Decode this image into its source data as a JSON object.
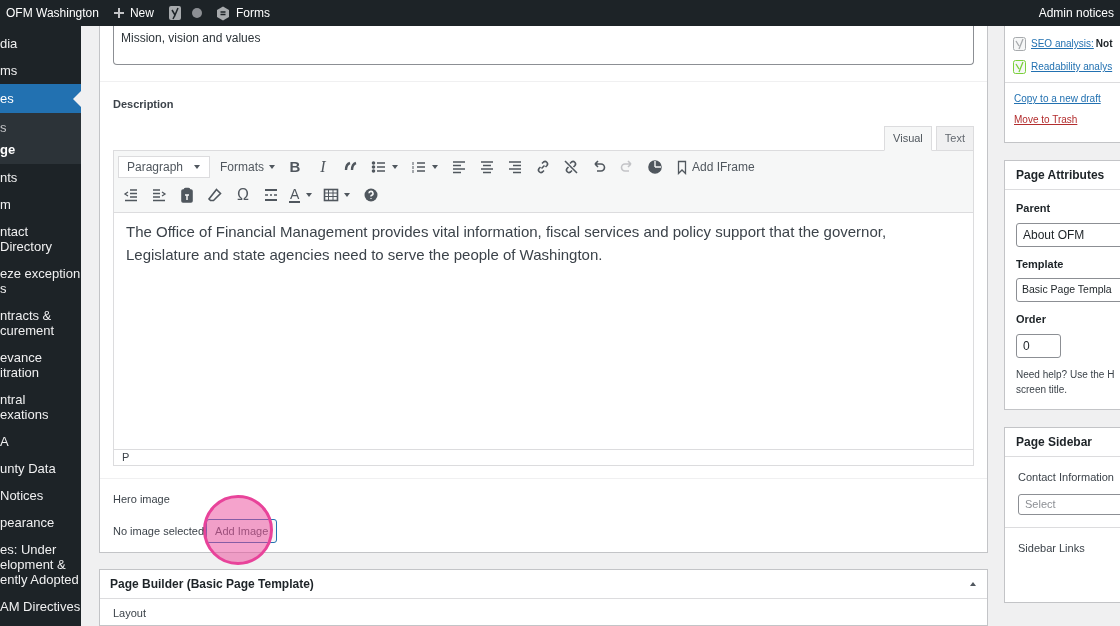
{
  "admin_bar": {
    "site": "OFM Washington",
    "new": "New",
    "forms": "Forms",
    "right": "Admin notices"
  },
  "sidebar": {
    "items": [
      {
        "label": "dia",
        "selected": false
      },
      {
        "label": "ms",
        "selected": false
      },
      {
        "label": "es",
        "selected": true,
        "children": [
          {
            "label": "s",
            "selected": false
          },
          {
            "label": "ge",
            "selected": true
          }
        ]
      },
      {
        "label": "nts",
        "selected": false
      },
      {
        "label": "m",
        "selected": false
      },
      {
        "label": "ntact Directory",
        "selected": false
      },
      {
        "label": "eze exception\ns",
        "selected": false
      },
      {
        "label": "ntracts &\ncurement",
        "selected": false
      },
      {
        "label": "evance\nitration",
        "selected": false
      },
      {
        "label": "ntral\nexations",
        "selected": false
      },
      {
        "label": "A",
        "selected": false
      },
      {
        "label": "unty Data",
        "selected": false
      },
      {
        "label": "Notices",
        "selected": false
      },
      {
        "label": "pearance",
        "selected": false
      },
      {
        "label": "es: Under\nelopment &\nently Adopted",
        "selected": false
      },
      {
        "label": "AM Directives",
        "selected": false
      }
    ]
  },
  "main": {
    "title_value": "Mission, vision and values",
    "description": {
      "label": "Description",
      "tabs": [
        {
          "label": "Visual",
          "selected": true
        },
        {
          "label": "Text",
          "selected": false
        }
      ],
      "toolbar": [
        [
          {
            "kind": "select",
            "label": "Paragraph"
          },
          {
            "kind": "menu",
            "label": "Formats"
          },
          {
            "kind": "bold",
            "label": "B"
          },
          {
            "kind": "italic",
            "label": "I"
          },
          {
            "kind": "icon",
            "disabled": false
          },
          {
            "kind": "split",
            "disabled": false
          },
          {
            "kind": "split",
            "disabled": false
          },
          {
            "kind": "icon",
            "disabled": false
          },
          {
            "kind": "icon",
            "disabled": false
          },
          {
            "kind": "icon",
            "disabled": false
          },
          {
            "kind": "icon",
            "disabled": false
          },
          {
            "kind": "icon",
            "disabled": false
          },
          {
            "kind": "icon",
            "disabled": false
          },
          {
            "kind": "icon",
            "disabled": true
          },
          {
            "kind": "icon",
            "disabled": false
          },
          {
            "kind": "iframe",
            "label": "Add IFrame"
          }
        ],
        [
          {
            "kind": "icon",
            "disabled": false
          },
          {
            "kind": "icon",
            "disabled": false
          },
          {
            "kind": "icon",
            "disabled": false
          },
          {
            "kind": "icon",
            "disabled": false
          },
          {
            "kind": "glyph",
            "label": "Ω"
          },
          {
            "kind": "icon",
            "disabled": false
          },
          {
            "kind": "color",
            "label": "A"
          },
          {
            "kind": "split",
            "disabled": false
          },
          {
            "kind": "icon",
            "disabled": false
          }
        ]
      ],
      "content": "The Office of Financial Management provides vital information, fiscal services and policy support that the governor, Legislature and state agencies need to serve the people of Washington.",
      "status": "P"
    },
    "hero_image": {
      "label": "Hero image",
      "status": "No image selected",
      "button": "Add Image",
      "click_highlight": true
    }
  },
  "page_builder": {
    "title": "Page Builder (Basic Page Template)",
    "expanded": true,
    "first_field": "Layout"
  },
  "publish_box": {
    "analyses": [
      {
        "link": "SEO analysis:",
        "value": "Not",
        "color": "#a7aaad"
      },
      {
        "link": "Readability analys",
        "color": "#7ad03a"
      }
    ],
    "copy_link": "Copy to a new draft",
    "trash_link": "Move to Trash"
  },
  "page_attributes": {
    "title": "Page Attributes",
    "parent_label": "Parent",
    "parent": "About OFM",
    "template_label": "Template",
    "template": "Basic Page Templa",
    "order_label": "Order",
    "order": "0",
    "help": "Need help? Use the H\nscreen title."
  },
  "page_sidebar": {
    "title": "Page Sidebar",
    "contact_label": "Contact Information",
    "contact_placeholder": "Select",
    "links_label": "Sidebar Links"
  }
}
